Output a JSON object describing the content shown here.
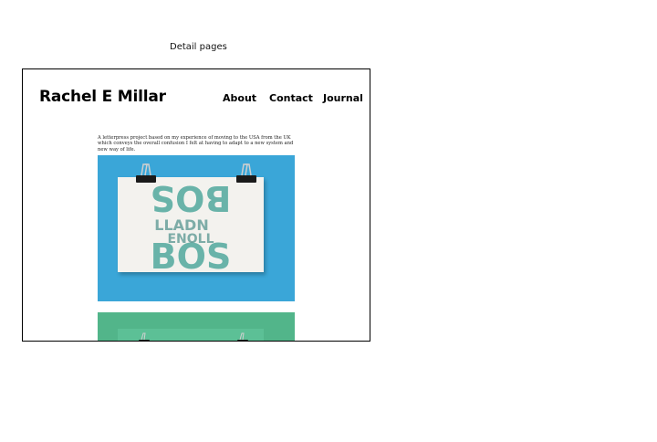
{
  "caption": "Detail pages",
  "site": {
    "title": "Rachel E Millar",
    "nav": [
      "About",
      "Contact",
      "Journal"
    ]
  },
  "project": {
    "description": "A letterpress project based on my experience of moving to the USA from the UK which conveys the overall confusion I felt at having to adapt to a new system and new way of life."
  },
  "colors": {
    "print1_background": "#3aa6d8",
    "print2_background": "#52b58a",
    "ink": "#3b9f93"
  }
}
